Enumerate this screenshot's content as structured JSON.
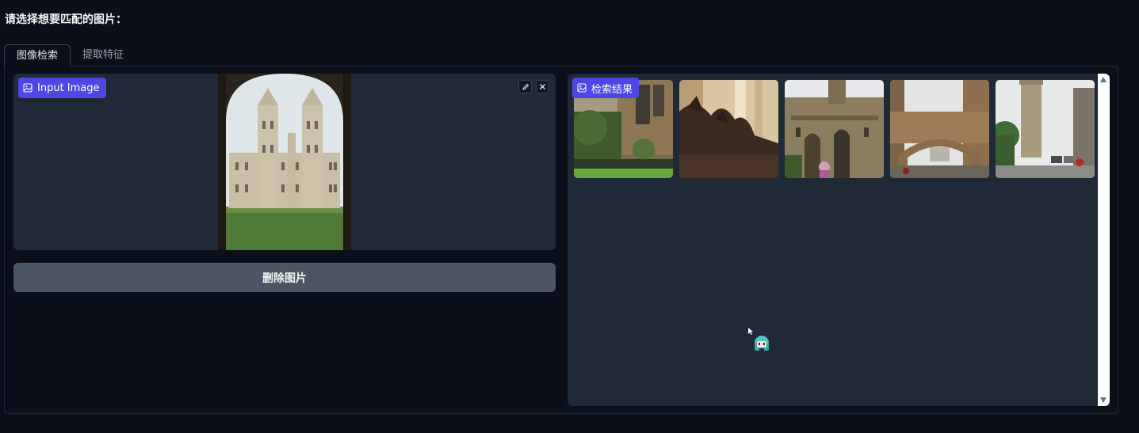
{
  "page": {
    "title": "请选择想要匹配的图片："
  },
  "tabs": [
    {
      "label": "图像检索",
      "active": true
    },
    {
      "label": "提取特征",
      "active": false
    }
  ],
  "input_panel": {
    "label": "Input Image",
    "label_icon": "image-icon",
    "edit_icon": "pencil-icon",
    "close_icon": "close-icon"
  },
  "actions": {
    "delete_label": "删除图片"
  },
  "results": {
    "label": "检索结果",
    "label_icon": "image-icon",
    "thumbnail_count": 5
  },
  "colors": {
    "background": "#0b0f19",
    "panel": "#1f2937",
    "accent": "#4f46e5",
    "button": "#4b5563"
  }
}
